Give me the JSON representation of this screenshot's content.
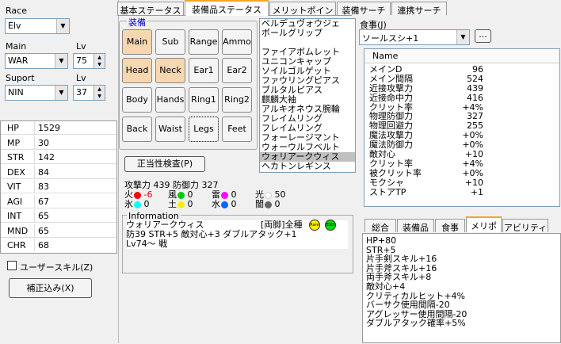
{
  "left": {
    "race_label": "Race",
    "race_value": "Elv",
    "main_label": "Main",
    "main_value": "WAR",
    "lv_label": "Lv",
    "main_lv": "75",
    "support_label": "Suport",
    "support_value": "NIN",
    "support_lv_label": "Lv",
    "support_lv": "37",
    "stats": [
      {
        "k": "HP",
        "v": "1529"
      },
      {
        "k": "MP",
        "v": "30"
      },
      {
        "k": "STR",
        "v": "142"
      },
      {
        "k": "DEX",
        "v": "84"
      },
      {
        "k": "VIT",
        "v": "83"
      },
      {
        "k": "AGI",
        "v": "67"
      },
      {
        "k": "INT",
        "v": "65"
      },
      {
        "k": "MND",
        "v": "65"
      },
      {
        "k": "CHR",
        "v": "68"
      }
    ],
    "user_skill_label": "ユーザースキル(Z)",
    "correction_button": "補正込み(X)"
  },
  "tabs": [
    "基本ステータス",
    "装備品ステータス",
    "メリットポイント",
    "装備サーチ",
    "連携サーチ"
  ],
  "equip": {
    "group_label": "装備",
    "slots": [
      "Main",
      "Sub",
      "Range",
      "Ammo",
      "Head",
      "Neck",
      "Ear1",
      "Ear2",
      "Body",
      "Hands",
      "Ring1",
      "Ring2",
      "Back",
      "Waist",
      "Legs",
      "Feet"
    ],
    "check_button": "正当性検査(P)",
    "attack_line": "攻撃力 439 防御力 327",
    "elements": [
      {
        "name": "火",
        "value": "-6",
        "color": "#ff0000"
      },
      {
        "name": "風",
        "value": "0",
        "color": "#00cc00"
      },
      {
        "name": "雷",
        "value": "0",
        "color": "#ff00ff"
      },
      {
        "name": "光",
        "value": "50",
        "color": "#ffffff"
      },
      {
        "name": "氷",
        "value": "0",
        "color": "#00ffff"
      },
      {
        "name": "土",
        "value": "0",
        "color": "#ffee00"
      },
      {
        "name": "水",
        "value": "0",
        "color": "#0066ff"
      },
      {
        "name": "闇",
        "value": "0",
        "color": "#666666"
      }
    ]
  },
  "item_list": [
    "ベルデュヴォウジェ",
    "ボールグリップ",
    "",
    "ファイアボムレット",
    "ユニコンキャップ",
    "ソイルゴルゲット",
    "ファウリングピアス",
    "ブルタルピアス",
    "麒麟大袖",
    "アルキオネウス腕輪",
    "フレイムリング",
    "フレイムリング",
    "フォーレージマント",
    "ウォーウルフベルト",
    "ウォリアークウィス",
    "ヘカトンレギンス"
  ],
  "info": {
    "label": "Information",
    "name": "ウォリアークウィス",
    "type": "[両脚]全種",
    "badge1": "Rare",
    "badge2": "EXO",
    "line2": "防39 STR+5 敵対心+3 ダブルアタック+1",
    "line3": "Lv74～ 戦"
  },
  "food": {
    "label": "食事(J)",
    "value": "ソールスシ+1",
    "dots": "..."
  },
  "table": {
    "header": "Name",
    "rows": [
      {
        "n": "メインD",
        "v": "96"
      },
      {
        "n": "メイン間隔",
        "v": "524"
      },
      {
        "n": "近接攻撃力",
        "v": "439"
      },
      {
        "n": "近接命中力",
        "v": "416"
      },
      {
        "n": "クリット率",
        "v": "+4%"
      },
      {
        "n": "物理防御力",
        "v": "327"
      },
      {
        "n": "物理回避力",
        "v": "255"
      },
      {
        "n": "魔法攻撃力",
        "v": "+0%"
      },
      {
        "n": "魔法防御力",
        "v": "+0%"
      },
      {
        "n": "敵対心",
        "v": "+10"
      },
      {
        "n": "クリット率",
        "v": "+4%"
      },
      {
        "n": "被クリット率",
        "v": "+0%"
      },
      {
        "n": "モクシャ",
        "v": "+10"
      },
      {
        "n": "ストアTP",
        "v": "+1"
      }
    ]
  },
  "bottom_tabs": [
    "総合",
    "装備品",
    "食事",
    "メリポ",
    "アビリティ"
  ],
  "merits": [
    "HP+80",
    "STR+5",
    "片手剣スキル+16",
    "片手斧スキル+16",
    "両手斧スキル+8",
    "敵対心+4",
    "クリティカルヒット+4%",
    "バーサク使用間隔-20",
    "アグレッサー使用間隔-20",
    "ダブルアタック確率+5%"
  ]
}
